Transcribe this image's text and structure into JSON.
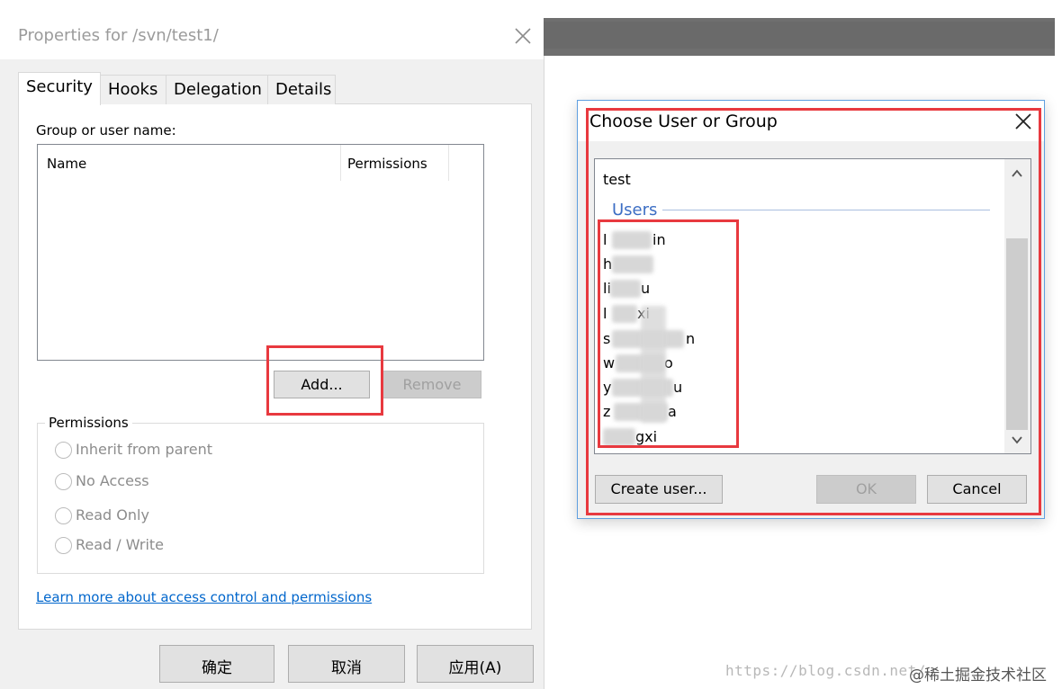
{
  "properties_dialog": {
    "title": "Properties for /svn/test1/",
    "tabs": [
      {
        "label": "Security"
      },
      {
        "label": "Hooks"
      },
      {
        "label": "Delegation"
      },
      {
        "label": "Details"
      }
    ],
    "group_label": "Group or user name:",
    "columns": {
      "name": "Name",
      "permissions": "Permissions"
    },
    "add_button": "Add...",
    "remove_button": "Remove",
    "permissions_title": "Permissions",
    "radio_options": [
      {
        "label": "Inherit from parent"
      },
      {
        "label": "No Access"
      },
      {
        "label": "Read Only"
      },
      {
        "label": "Read / Write"
      }
    ],
    "help_link": "Learn more about access control and permissions",
    "ok_button": "确定",
    "cancel_button": "取消",
    "apply_button": "应用(A)"
  },
  "choose_dialog": {
    "title": "Choose User or Group",
    "entries": {
      "first": "test",
      "section": "Users"
    },
    "visible_user_fragments": [
      {
        "start": "l",
        "end": "in"
      },
      {
        "start": "h",
        "end": ""
      },
      {
        "start": "li",
        "end": "u"
      },
      {
        "start": "l",
        "end": "xi"
      },
      {
        "start": "s",
        "end": "n"
      },
      {
        "start": "w",
        "end": "o"
      },
      {
        "start": "y",
        "end": "u"
      },
      {
        "start": "z",
        "end": "a"
      },
      {
        "start": "",
        "end": "gxi"
      }
    ],
    "create_user_button": "Create user...",
    "ok_button": "OK",
    "cancel_button": "Cancel"
  },
  "watermark": {
    "url_text": "https://blog.csdn.net/",
    "site_text": "@稀土掘金技术社区"
  },
  "colors": {
    "highlight_red": "#e8393f",
    "link_blue": "#0066cc",
    "users_header_blue": "#3c6ec4"
  },
  "icons": [
    "close-icon",
    "scroll-up-icon",
    "scroll-down-icon"
  ]
}
